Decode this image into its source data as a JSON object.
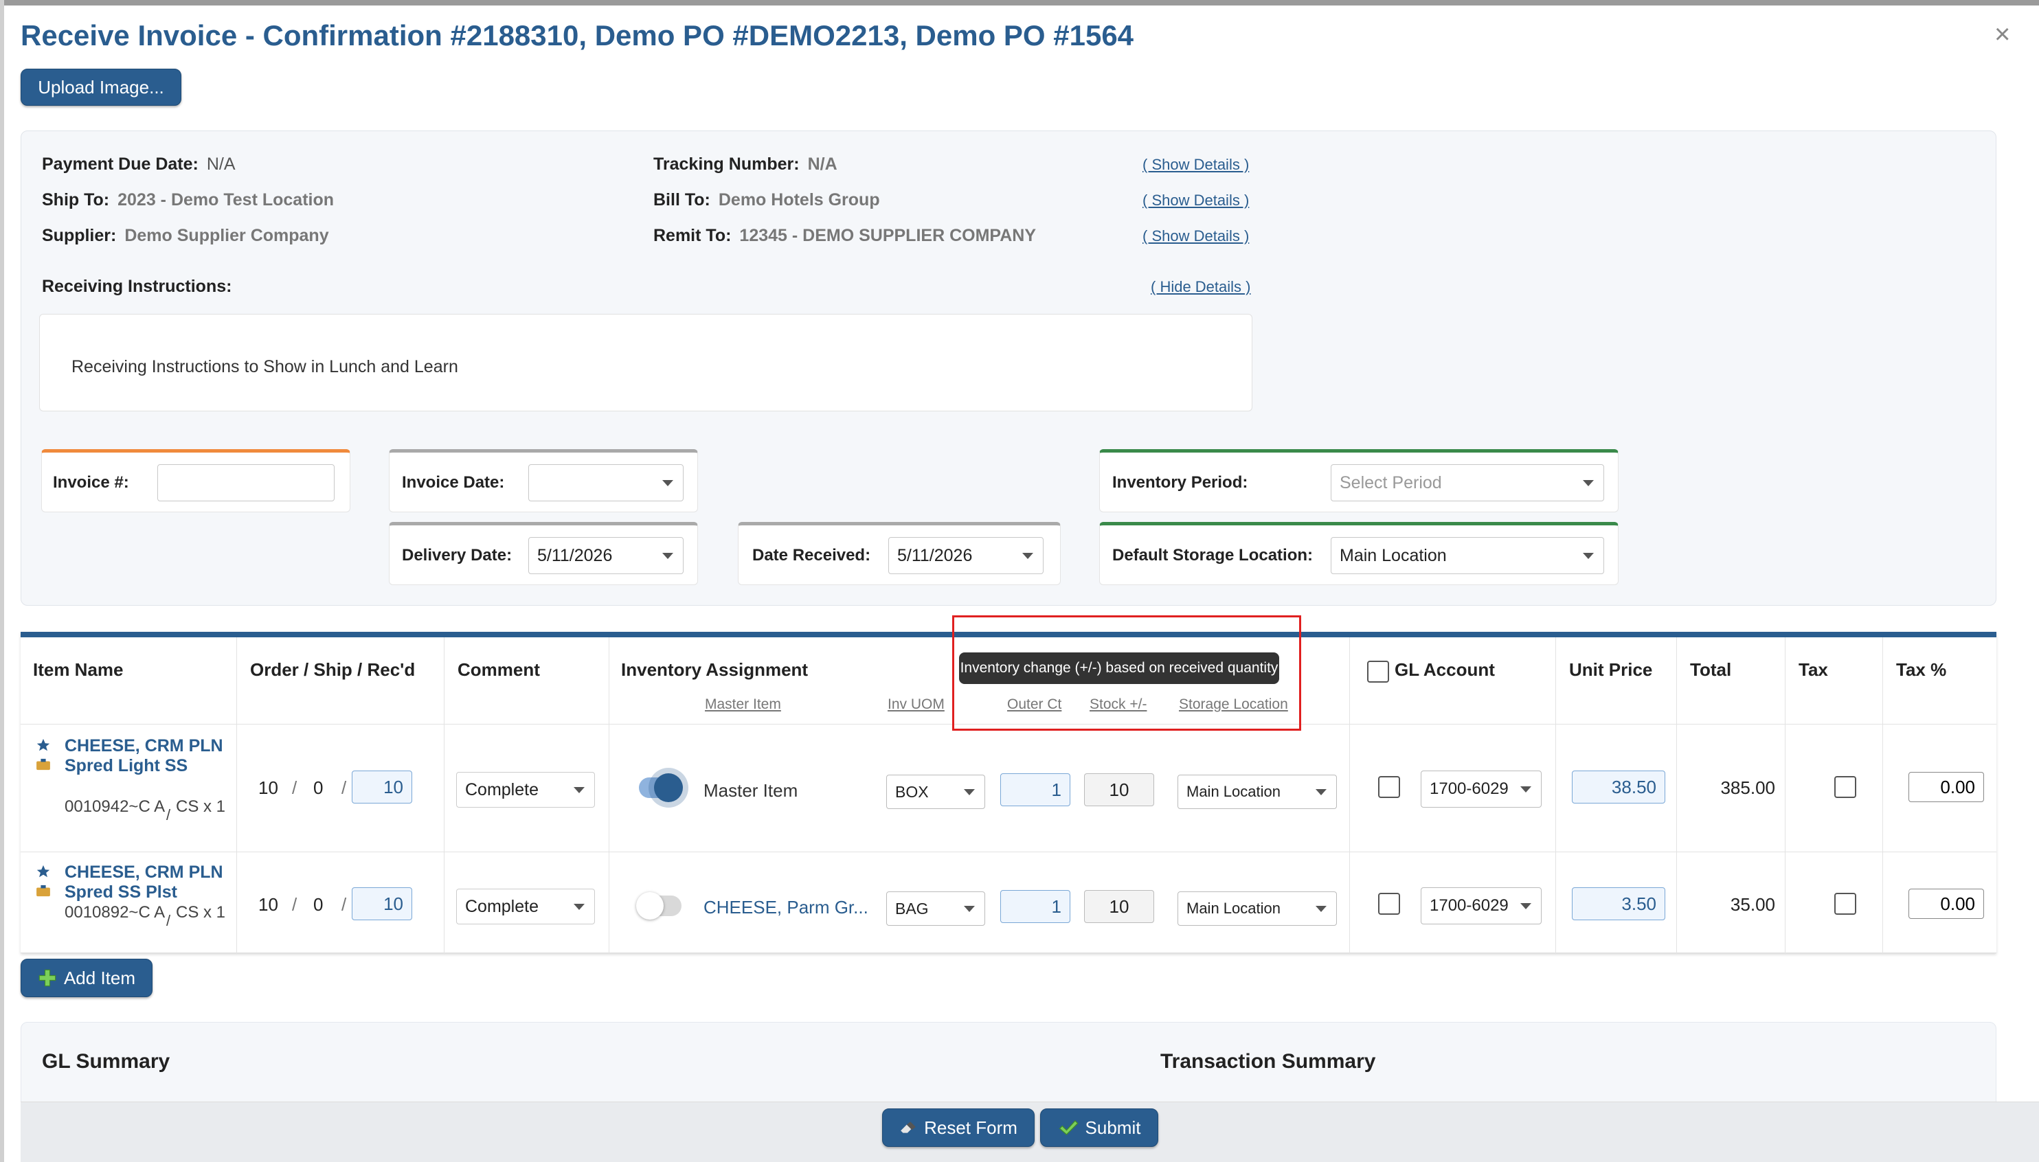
{
  "title": "Receive Invoice - Confirmation #2188310, Demo PO #DEMO2213, Demo PO #1564",
  "upload_button": "Upload Image...",
  "header_info": {
    "payment_due_label": "Payment Due Date:",
    "payment_due_value": "N/A",
    "ship_to_label": "Ship To:",
    "ship_to_value": "2023 - Demo Test Location",
    "supplier_label": "Supplier:",
    "supplier_value": "Demo Supplier Company",
    "tracking_label": "Tracking Number:",
    "tracking_value": "N/A",
    "bill_to_label": "Bill To:",
    "bill_to_value": "Demo Hotels Group",
    "remit_to_label": "Remit To:",
    "remit_to_value": "12345 - DEMO SUPPLIER COMPANY",
    "show_details": "( Show Details )",
    "hide_details": "( Hide Details )",
    "receiving_instructions_label": "Receiving Instructions:",
    "receiving_instructions_text": "Receiving Instructions to Show in Lunch and Learn"
  },
  "fields": {
    "invoice_number_label": "Invoice #:",
    "invoice_number_value": "",
    "invoice_date_label": "Invoice Date:",
    "invoice_date_value": "",
    "delivery_date_label": "Delivery Date:",
    "delivery_date_value": "5/11/2026",
    "date_received_label": "Date Received:",
    "date_received_value": "5/11/2026",
    "inventory_period_label": "Inventory Period:",
    "inventory_period_placeholder": "Select Period",
    "default_storage_label": "Default Storage Location:",
    "default_storage_value": "Main Location"
  },
  "table": {
    "headers": {
      "item_name": "Item Name",
      "order_ship_recd": "Order / Ship / Rec'd",
      "comment": "Comment",
      "inventory_assignment": "Inventory Assignment",
      "gl_account": "GL Account",
      "unit_price": "Unit Price",
      "total": "Total",
      "tax": "Tax",
      "tax_pct": "Tax %"
    },
    "sub_headers": {
      "master_item": "Master Item",
      "inv_uom": "Inv UOM",
      "outer_ct": "Outer Ct",
      "stock": "Stock +/-",
      "storage_location": "Storage Location"
    },
    "tooltip": "Inventory change (+/-) based on received quantity",
    "slash": "/",
    "rows": [
      {
        "name": "CHEESE, CRM PLN Spred Light SS",
        "code": "0010942~C A",
        "pack": "CS x 1",
        "order": "10",
        "ship": "0",
        "recd": "10",
        "comment": "Complete",
        "toggle_on": true,
        "assignment": "Master Item",
        "uom": "BOX",
        "outer_ct": "1",
        "stock": "10",
        "storage": "Main Location",
        "gl_account": "1700-6029",
        "unit_price": "38.50",
        "total": "385.00",
        "tax_pct": "0.00"
      },
      {
        "name": "CHEESE, CRM PLN Spred SS Plst",
        "code": "0010892~C A",
        "pack": "CS x 1",
        "order": "10",
        "ship": "0",
        "recd": "10",
        "comment": "Complete",
        "toggle_on": false,
        "assignment": "CHEESE, Parm Gr...",
        "uom": "BAG",
        "outer_ct": "1",
        "stock": "10",
        "storage": "Main Location",
        "gl_account": "1700-6029",
        "unit_price": "3.50",
        "total": "35.00",
        "tax_pct": "0.00"
      }
    ]
  },
  "add_item_button": "Add Item",
  "gl_summary_title": "GL Summary",
  "transaction_summary_title": "Transaction Summary",
  "reset_button": "Reset Form",
  "submit_button": "Submit",
  "colors": {
    "primary": "#2a5d8f",
    "invoice_accent": "#f08a3c",
    "date_accent": "#a9a9a9",
    "inventory_accent": "#3a8a4a",
    "highlight": "#e02020"
  }
}
